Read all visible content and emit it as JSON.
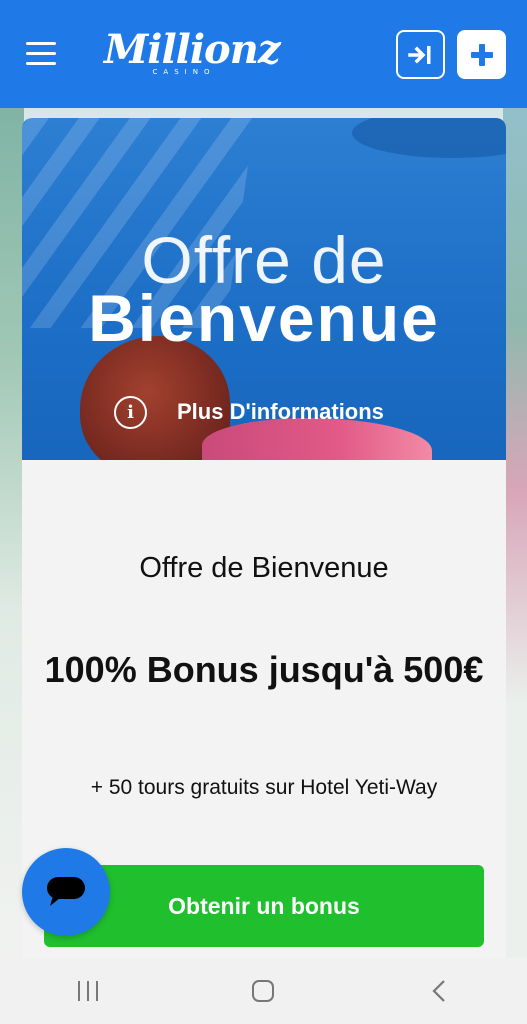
{
  "header": {
    "logo_text": "Millionz",
    "logo_sub": "CASINO"
  },
  "banner": {
    "title_line1": "Offre de",
    "title_line2": "Bienvenue",
    "info_label": "Plus D'informations"
  },
  "offer": {
    "title": "Offre de Bienvenue",
    "bonus": "100% Bonus jusqu'à 500€",
    "spins": "+ 50 tours gratuits sur Hotel Yeti-Way",
    "cta_label": "Obtenir un bonus"
  },
  "colors": {
    "header_blue": "#1f7ae8",
    "cta_green": "#1fbf2e",
    "card_bg": "#f3f3f3"
  },
  "icons": {
    "menu": "hamburger-icon",
    "login": "login-icon",
    "signup": "plus-icon",
    "info": "info-icon",
    "chat": "chat-icon",
    "nav_recent": "recent-apps-icon",
    "nav_home": "home-icon",
    "nav_back": "back-icon"
  }
}
